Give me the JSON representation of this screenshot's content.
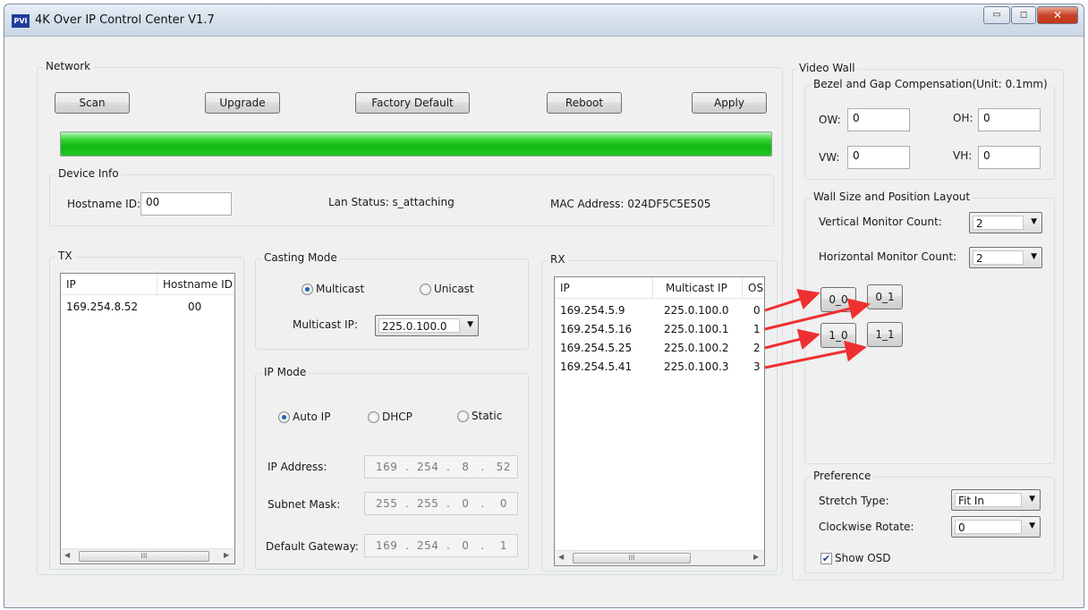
{
  "window": {
    "title": "4K Over IP Control Center V1.7",
    "app_icon_text": "PVI"
  },
  "titlebar_buttons": {
    "minimize": "▭",
    "maximize": "◻",
    "close": "✕"
  },
  "network": {
    "label": "Network",
    "buttons": {
      "scan": "Scan",
      "upgrade": "Upgrade",
      "factory_default": "Factory Default",
      "reboot": "Reboot",
      "apply": "Apply"
    },
    "progress_percent": 100,
    "progress_color": "#1ec41e"
  },
  "device_info": {
    "label": "Device Info",
    "hostname_label": "Hostname ID:",
    "hostname_value": "00",
    "lan_status": "Lan Status: s_attaching",
    "mac_address": "MAC Address: 024DF5C5E505"
  },
  "tx": {
    "label": "TX",
    "columns": [
      "IP",
      "Hostname ID"
    ],
    "rows": [
      {
        "ip": "169.254.8.52",
        "hostname": "00"
      }
    ],
    "scroll_thumb": "III"
  },
  "casting_mode": {
    "label": "Casting Mode",
    "multicast": "Multicast",
    "unicast": "Unicast",
    "selected": "Multicast",
    "multicast_ip_label": "Multicast IP:",
    "multicast_ip_value": "225.0.100.0"
  },
  "ip_mode": {
    "label": "IP Mode",
    "auto_ip": "Auto IP",
    "dhcp": "DHCP",
    "static": "Static",
    "selected": "Auto IP",
    "ip_address_label": "IP Address:",
    "ip_address_value": "169  .  254  .   8   .   52",
    "subnet_mask_label": "Subnet Mask:",
    "subnet_mask_value": "255  .  255  .   0   .    0",
    "gateway_label": "Default Gateway:",
    "gateway_value": "169  .  254  .   0   .    1"
  },
  "rx": {
    "label": "RX",
    "columns": [
      "IP",
      "Multicast IP",
      "OSD"
    ],
    "rows": [
      {
        "ip": "169.254.5.9",
        "multicast_ip": "225.0.100.0",
        "osd": "0"
      },
      {
        "ip": "169.254.5.16",
        "multicast_ip": "225.0.100.1",
        "osd": "1"
      },
      {
        "ip": "169.254.5.25",
        "multicast_ip": "225.0.100.2",
        "osd": "2"
      },
      {
        "ip": "169.254.5.41",
        "multicast_ip": "225.0.100.3",
        "osd": "3"
      }
    ],
    "scroll_thumb": "III"
  },
  "video_wall": {
    "label": "Video Wall",
    "bezel": {
      "label": "Bezel and Gap Compensation(Unit: 0.1mm)",
      "ow_label": "OW:",
      "ow_value": "0",
      "oh_label": "OH:",
      "oh_value": "0",
      "vw_label": "VW:",
      "vw_value": "0",
      "vh_label": "VH:",
      "vh_value": "0"
    },
    "wall_layout": {
      "label": "Wall Size and Position Layout",
      "vertical_label": "Vertical Monitor Count:",
      "vertical_value": "2",
      "horizontal_label": "Horizontal Monitor Count:",
      "horizontal_value": "2",
      "positions": [
        "0_0",
        "0_1",
        "1_0",
        "1_1"
      ]
    },
    "preference": {
      "label": "Preference",
      "stretch_label": "Stretch Type:",
      "stretch_value": "Fit In",
      "rotate_label": "Clockwise Rotate:",
      "rotate_value": "0",
      "show_osd_label": "Show OSD",
      "show_osd_checked": true
    }
  },
  "annotation_color": "#ee3030"
}
